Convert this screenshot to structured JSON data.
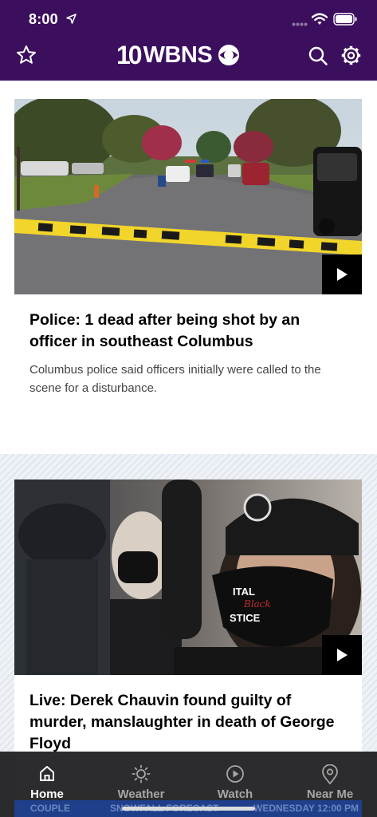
{
  "status_bar": {
    "time": "8:00"
  },
  "header": {
    "logo_number": "10",
    "logo_text": "WBNS"
  },
  "articles": [
    {
      "headline": "Police: 1 dead after being shot by an officer in southeast Columbus",
      "summary": "Columbus police said officers initially were called to the scene for a disturbance."
    },
    {
      "headline": "Live: Derek Chauvin found guilty of murder, manslaughter in death of George Floyd"
    }
  ],
  "mask_text": [
    "ITAL",
    "Black",
    "STICE"
  ],
  "ticker": {
    "left": "COUPLE",
    "middle": "SNOWFALL FORECAST",
    "right": "WEDNESDAY 12:00 PM"
  },
  "tabbar": {
    "tabs": [
      {
        "label": "Home",
        "icon": "home-icon",
        "active": true
      },
      {
        "label": "Weather",
        "icon": "sun-icon",
        "active": false
      },
      {
        "label": "Watch",
        "icon": "play-circle-icon",
        "active": false
      },
      {
        "label": "Near Me",
        "icon": "location-pin-icon",
        "active": false
      }
    ]
  },
  "colors": {
    "header_bg": "#3b0f5e",
    "tabbar_bg": "#1c1c1e"
  }
}
